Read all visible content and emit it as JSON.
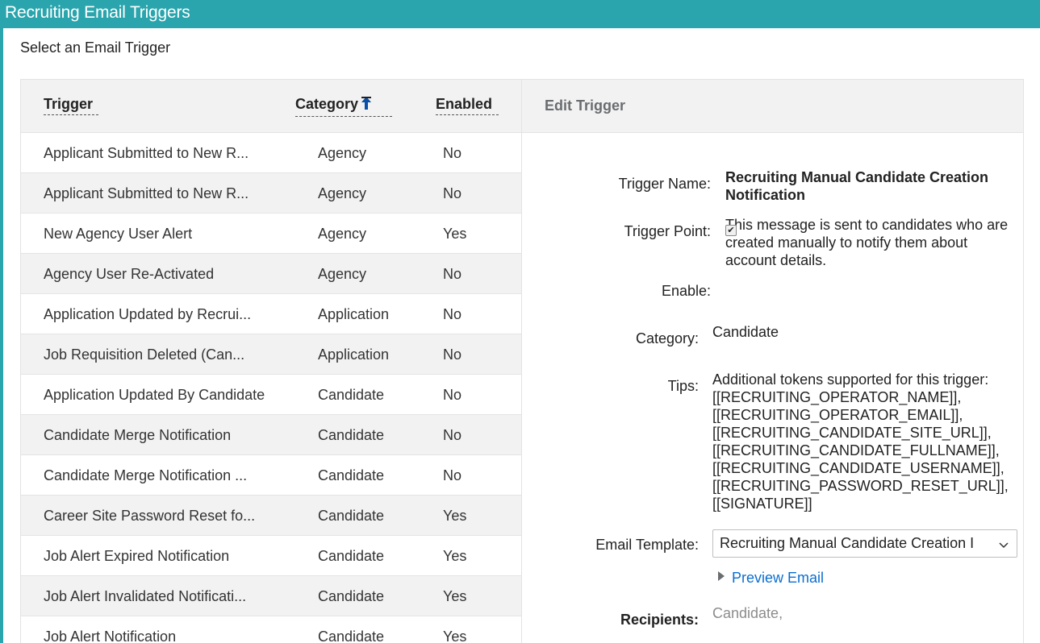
{
  "window": {
    "title": "Recruiting Email Triggers"
  },
  "list": {
    "heading": "Select an Email Trigger",
    "columns": {
      "trigger": "Trigger",
      "category": "Category",
      "enabled": "Enabled"
    },
    "sort": {
      "column": "category",
      "direction": "ascending",
      "icon": "sort-ascending-icon"
    },
    "rows": [
      {
        "trigger": "Applicant Submitted to New R...",
        "category": "Agency",
        "enabled": "No"
      },
      {
        "trigger": "Applicant Submitted to New R...",
        "category": "Agency",
        "enabled": "No"
      },
      {
        "trigger": "New Agency User Alert",
        "category": "Agency",
        "enabled": "Yes"
      },
      {
        "trigger": "Agency User Re-Activated",
        "category": "Agency",
        "enabled": "No"
      },
      {
        "trigger": "Application Updated by Recrui...",
        "category": "Application",
        "enabled": "No"
      },
      {
        "trigger": "Job Requisition Deleted (Can...",
        "category": "Application",
        "enabled": "No"
      },
      {
        "trigger": "Application Updated By Candidate",
        "category": "Candidate",
        "enabled": "No"
      },
      {
        "trigger": "Candidate Merge Notification",
        "category": "Candidate",
        "enabled": "No"
      },
      {
        "trigger": "Candidate Merge Notification ...",
        "category": "Candidate",
        "enabled": "No"
      },
      {
        "trigger": "Career Site Password Reset fo...",
        "category": "Candidate",
        "enabled": "Yes"
      },
      {
        "trigger": "Job Alert Expired Notification",
        "category": "Candidate",
        "enabled": "Yes"
      },
      {
        "trigger": "Job Alert Invalidated Notificati...",
        "category": "Candidate",
        "enabled": "Yes"
      },
      {
        "trigger": "Job Alert Notification",
        "category": "Candidate",
        "enabled": "Yes"
      }
    ]
  },
  "edit": {
    "heading": "Edit Trigger",
    "trigger_name_label": "Trigger Name:",
    "trigger_name_line1": "Recruiting Manual Candidate Creation",
    "trigger_name_line2": "Notification",
    "trigger_point_label": "Trigger Point:",
    "trigger_point_line1": "This message is sent to candidates who are",
    "trigger_point_line2": "created manually to notify them about",
    "trigger_point_line3": "account details.",
    "enable_label": "Enable:",
    "enabled": true,
    "category_label": "Category:",
    "category_value": "Candidate",
    "tips_label": "Tips:",
    "tips_lines": [
      "Additional tokens supported for this trigger:",
      "[[RECRUITING_OPERATOR_NAME]],",
      "[[RECRUITING_OPERATOR_EMAIL]],",
      "[[RECRUITING_CANDIDATE_SITE_URL]],",
      "[[RECRUITING_CANDIDATE_FULLNAME]],",
      "[[RECRUITING_CANDIDATE_USERNAME]],",
      "[[RECRUITING_PASSWORD_RESET_URL]],",
      "[[SIGNATURE]]"
    ],
    "email_template_label": "Email Template:",
    "email_template_value": "Recruiting Manual Candidate Creation I",
    "preview_label": "Preview Email",
    "recipients_label": "Recipients:",
    "recipients_value": "Candidate,"
  },
  "colors": {
    "header_teal": "#2aa5ad",
    "link_blue": "#0a6ed1",
    "sort_icon_blue": "#0a4fa8"
  }
}
